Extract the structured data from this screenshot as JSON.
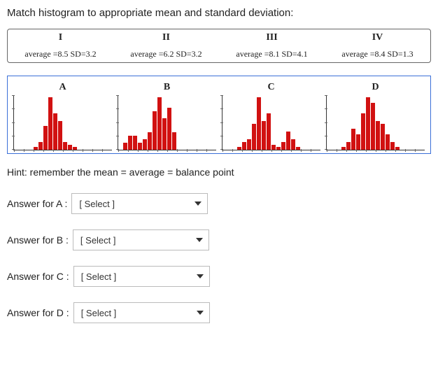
{
  "title": "Match histogram to appropriate mean and standard deviation:",
  "options": {
    "I": {
      "label": "I",
      "desc": "average =8.5  SD=3.2"
    },
    "II": {
      "label": "II",
      "desc": "average =6.2  SD=3.2"
    },
    "III": {
      "label": "III",
      "desc": "average =8.1  SD=4.1"
    },
    "IV": {
      "label": "IV",
      "desc": "average =8.4  SD=1.3"
    }
  },
  "histograms": {
    "A": {
      "label": "A"
    },
    "B": {
      "label": "B"
    },
    "C": {
      "label": "C"
    },
    "D": {
      "label": "D"
    }
  },
  "hint": "Hint: remember the mean = average = balance point",
  "answers": {
    "A": {
      "label": "Answer for A :",
      "value": "[ Select ]"
    },
    "B": {
      "label": "Answer for B :",
      "value": "[ Select ]"
    },
    "C": {
      "label": "Answer for C :",
      "value": "[ Select ]"
    },
    "D": {
      "label": "Answer for D :",
      "value": "[ Select ]"
    }
  },
  "chart_data": [
    {
      "type": "bar",
      "label": "A",
      "mean_approx": 8.4,
      "sd_approx": 1.3,
      "values": [
        0,
        0,
        0,
        0,
        2,
        6,
        18,
        40,
        28,
        22,
        6,
        4,
        2,
        0,
        0,
        0,
        0,
        0,
        0,
        0
      ],
      "ylim": [
        0,
        40
      ],
      "xlim": [
        0,
        20
      ]
    },
    {
      "type": "bar",
      "label": "B",
      "mean_approx": 6.2,
      "sd_approx": 3.2,
      "values": [
        0,
        4,
        8,
        8,
        4,
        6,
        10,
        22,
        30,
        18,
        24,
        10,
        0,
        0,
        0,
        0,
        0,
        0,
        0,
        0
      ],
      "ylim": [
        0,
        30
      ],
      "xlim": [
        0,
        20
      ]
    },
    {
      "type": "bar",
      "label": "C",
      "mean_approx": 8.1,
      "sd_approx": 4.1,
      "values": [
        0,
        0,
        0,
        2,
        6,
        8,
        20,
        40,
        22,
        28,
        4,
        2,
        6,
        14,
        8,
        2,
        0,
        0,
        0,
        0
      ],
      "ylim": [
        0,
        40
      ],
      "xlim": [
        0,
        20
      ]
    },
    {
      "type": "bar",
      "label": "D",
      "mean_approx": 8.5,
      "sd_approx": 3.2,
      "values": [
        0,
        0,
        0,
        2,
        6,
        16,
        12,
        28,
        40,
        36,
        22,
        20,
        12,
        6,
        2,
        0,
        0,
        0,
        0,
        0
      ],
      "ylim": [
        0,
        40
      ],
      "xlim": [
        0,
        20
      ]
    }
  ]
}
